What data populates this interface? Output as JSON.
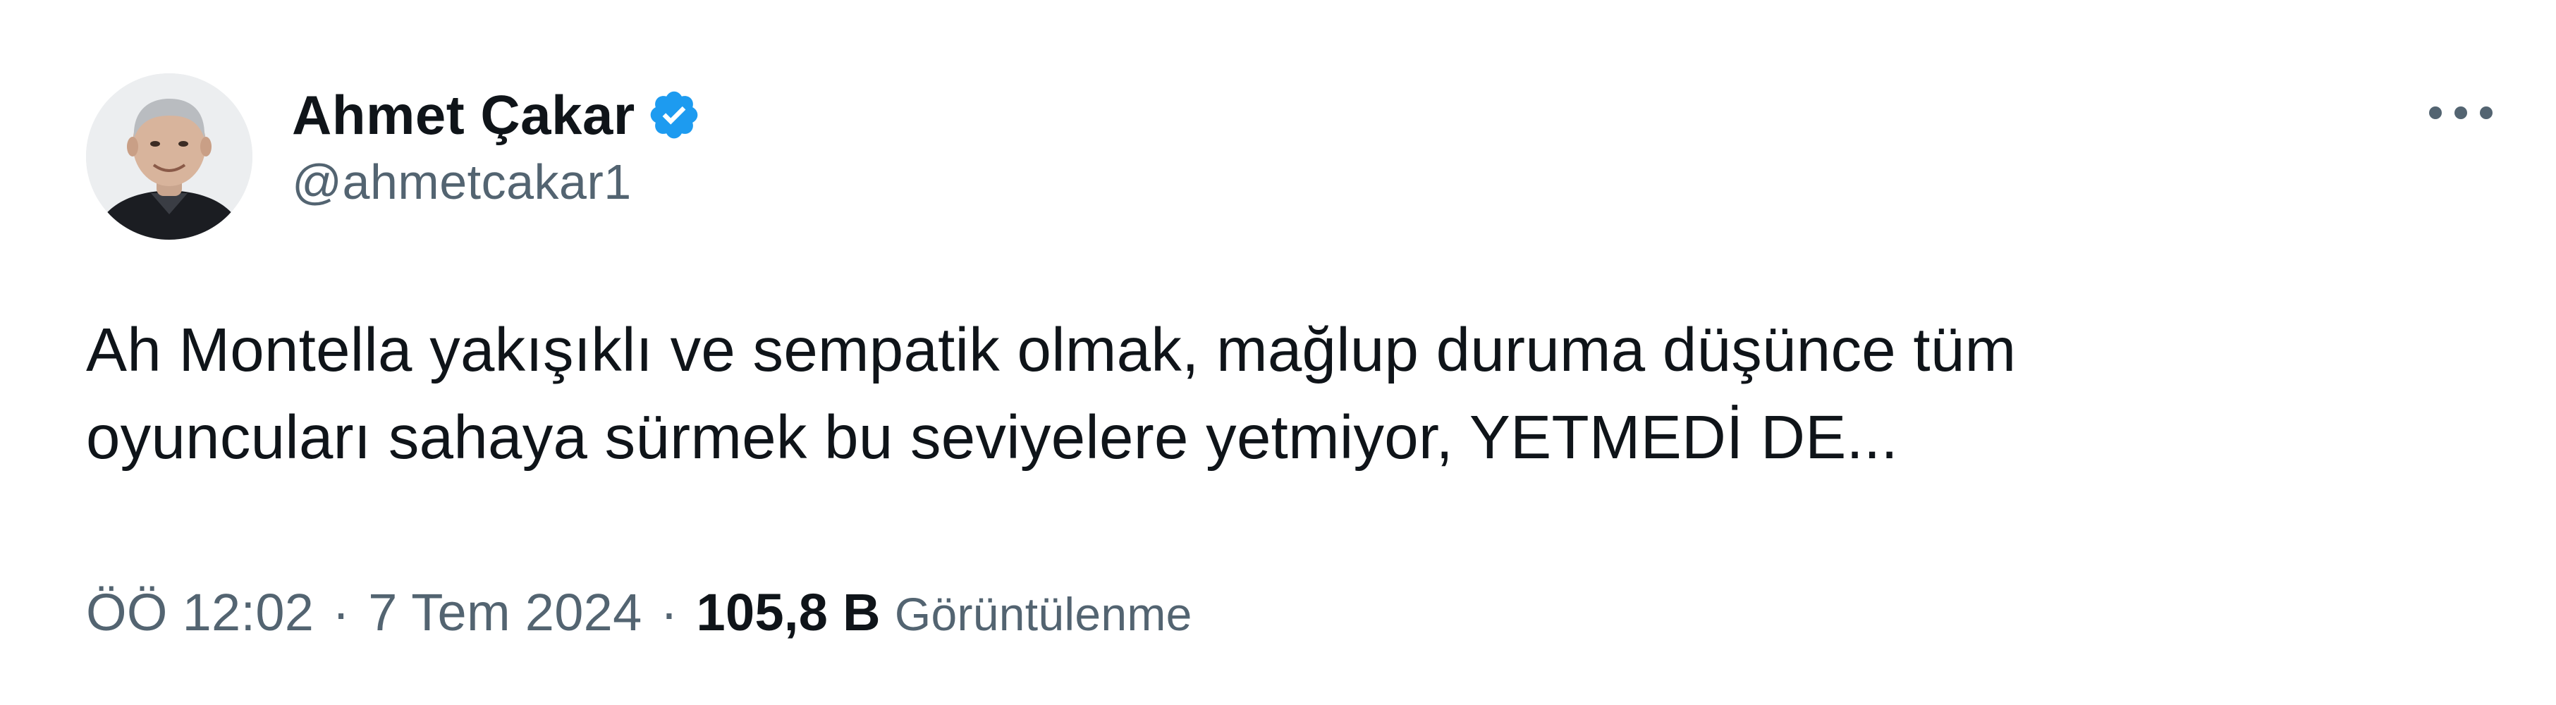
{
  "author": {
    "display_name": "Ahmet Çakar",
    "handle": "@ahmetcakar1",
    "verified": true,
    "verified_color": "#1d9bf0"
  },
  "icons": {
    "verified": "verified-badge-icon",
    "more": "more-horizontal-icon",
    "avatar": "profile-photo"
  },
  "tweet": {
    "text": "Ah Montella yakışıklı ve sempatik olmak, mağlup duruma düşünce tüm\noyuncuları sahaya sürmek bu seviyelere yetmiyor, YETMEDİ DE..."
  },
  "meta": {
    "time": "ÖÖ 12:02",
    "date": "7 Tem 2024",
    "separator": "·",
    "views_count": "105,8 B",
    "views_label": "Görüntülenme"
  },
  "colors": {
    "primary_text": "#0f1419",
    "secondary_text": "#536471"
  }
}
